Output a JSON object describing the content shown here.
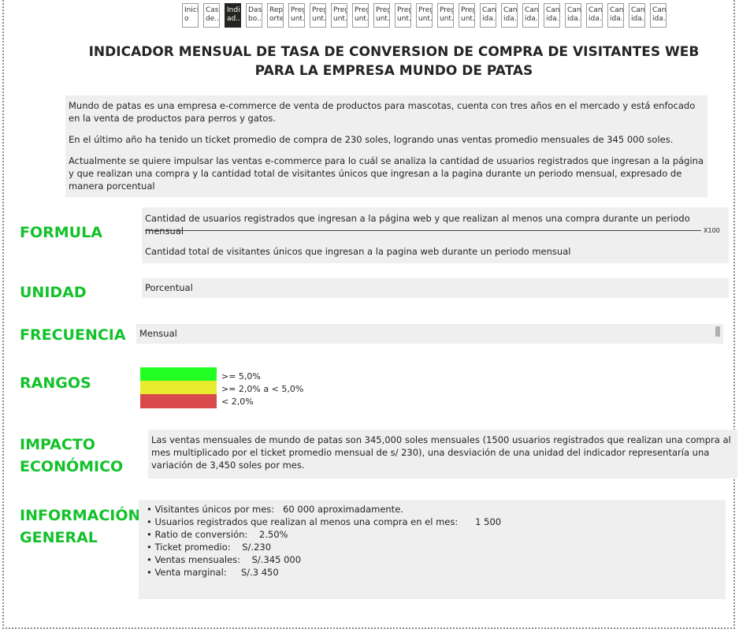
{
  "tabs": [
    {
      "label": "Inici\no",
      "active": false
    },
    {
      "label": "Caso\nde...",
      "active": false
    },
    {
      "label": "Indic\nad...",
      "active": true
    },
    {
      "label": "Dash\nbo...",
      "active": false
    },
    {
      "label": "Rep\norte",
      "active": false
    },
    {
      "label": "Preg\nunt...",
      "active": false
    },
    {
      "label": "Preg\nunt...",
      "active": false
    },
    {
      "label": "Preg\nunt...",
      "active": false
    },
    {
      "label": "Preg\nunt...",
      "active": false
    },
    {
      "label": "Preg\nunt...",
      "active": false
    },
    {
      "label": "Preg\nunt...",
      "active": false
    },
    {
      "label": "Preg\nunt...",
      "active": false
    },
    {
      "label": "Preg\nunt...",
      "active": false
    },
    {
      "label": "Preg\nunt...",
      "active": false
    },
    {
      "label": "Cant\nida...",
      "active": false
    },
    {
      "label": "Cant\nida...",
      "active": false
    },
    {
      "label": "Cant\nida...",
      "active": false
    },
    {
      "label": "Cant\nida...",
      "active": false
    },
    {
      "label": "Cant\nida...",
      "active": false
    },
    {
      "label": "Cant\nida...",
      "active": false
    },
    {
      "label": "Cant\nida...",
      "active": false
    },
    {
      "label": "Cant\nida...",
      "active": false
    },
    {
      "label": "Cant\nida...",
      "active": false
    }
  ],
  "title_line1": "INDICADOR MENSUAL DE TASA DE CONVERSION DE COMPRA DE VISITANTES WEB",
  "title_line2": "PARA LA EMPRESA MUNDO DE PATAS",
  "intro": {
    "p1": "Mundo de patas es una empresa e-commerce de venta de productos para mascotas, cuenta con tres años en el mercado y está enfocado en la venta de productos para perros y gatos.",
    "p2": "En el último año ha tenido un ticket promedio de compra de 230 soles, logrando unas ventas promedio mensuales de 345 000 soles.",
    "p3": "Actualmente se quiere impulsar las ventas e-commerce para lo cuál se analiza la cantidad de usuarios registrados que ingresan a la página y que realizan una compra y la cantidad total de visitantes únicos que ingresan a la pagina durante un periodo mensual, expresado de manera porcentual"
  },
  "labels": {
    "formula": "FORMULA",
    "unidad": "UNIDAD",
    "frecuencia": "FRECUENCIA",
    "rangos": "RANGOS",
    "impacto1": "IMPACTO",
    "impacto2": "ECONÓMICO",
    "info1": "INFORMACIÓN",
    "info2": "GENERAL"
  },
  "formula": {
    "numerator": "Cantidad de usuarios registrados que ingresan a la página web y que realizan al menos una compra durante un periodo mensual",
    "multiplier": "X100",
    "denominator": "Cantidad total de visitantes únicos  que ingresan a la pagina web durante un periodo mensual"
  },
  "unidad": "Porcentual",
  "frecuencia": "Mensual",
  "rangos": [
    {
      "text": ">= 5,0%",
      "color": "#22ff22"
    },
    {
      "text": ">= 2,0% a < 5,0%",
      "color": "#e8ea2e"
    },
    {
      "text": "< 2,0%",
      "color": "#d9484c"
    }
  ],
  "impacto": "Las ventas mensuales de mundo de patas son 345,000 soles mensuales (1500 usuarios registrados que realizan una compra al mes multiplicado por el ticket promedio mensual de s/ 230), una desviación de una unidad del indicador representaría una variación de 3,450 soles por mes.",
  "info": [
    "• Visitantes únicos por mes:   60 000 aproximadamente.",
    "• Usuarios registrados que realizan al menos una compra en el mes:      1 500",
    "• Ratio de conversión:    2.50%",
    "• Ticket promedio:    S/.230",
    "• Ventas mensuales:    S/.345 000",
    "• Venta marginal:     S/.3 450"
  ],
  "colors": {
    "accent_green": "#13c22b",
    "panel": "#efefef"
  }
}
